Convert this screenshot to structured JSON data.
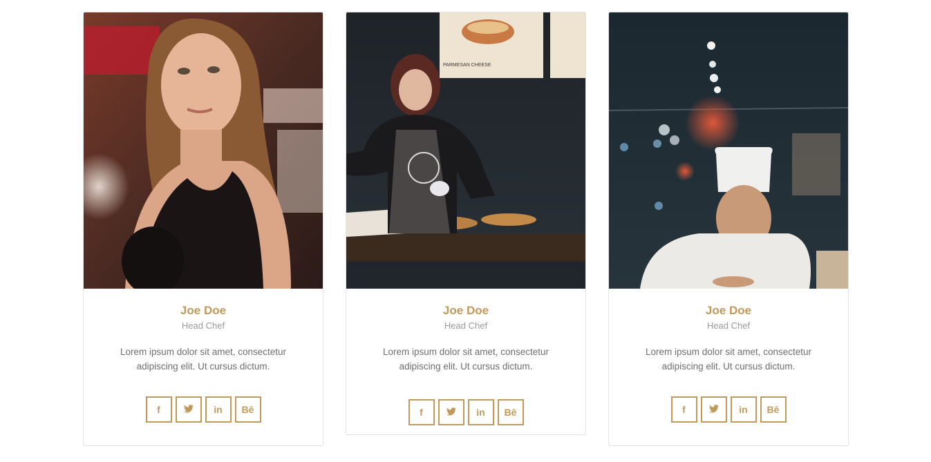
{
  "team": {
    "members": [
      {
        "name": "Joe Doe",
        "role": "Head Chef",
        "bio": "Lorem ipsum dolor sit amet, consectetur adipiscing elit. Ut cursus dictum.",
        "photo_sign": ""
      },
      {
        "name": "Joe Doe",
        "role": "Head Chef",
        "bio": "Lorem ipsum dolor sit amet, consectetur adipiscing elit. Ut cursus dictum.",
        "photo_sign": "PARMESAN CHEESE"
      },
      {
        "name": "Joe Doe",
        "role": "Head Chef",
        "bio": "Lorem ipsum dolor sit amet, consectetur adipiscing elit. Ut cursus dictum.",
        "photo_sign": ""
      }
    ],
    "social_icons": [
      {
        "icon": "facebook-icon",
        "glyph": "f"
      },
      {
        "icon": "twitter-icon",
        "glyph": "🐦"
      },
      {
        "icon": "linkedin-icon",
        "glyph": "in"
      },
      {
        "icon": "behance-icon",
        "glyph": "Bē"
      }
    ],
    "colors": {
      "accent": "#c19a5b",
      "role_text": "#9a9a9a",
      "bio_text": "#6e6e6e",
      "card_border": "#e3e3e3"
    }
  }
}
